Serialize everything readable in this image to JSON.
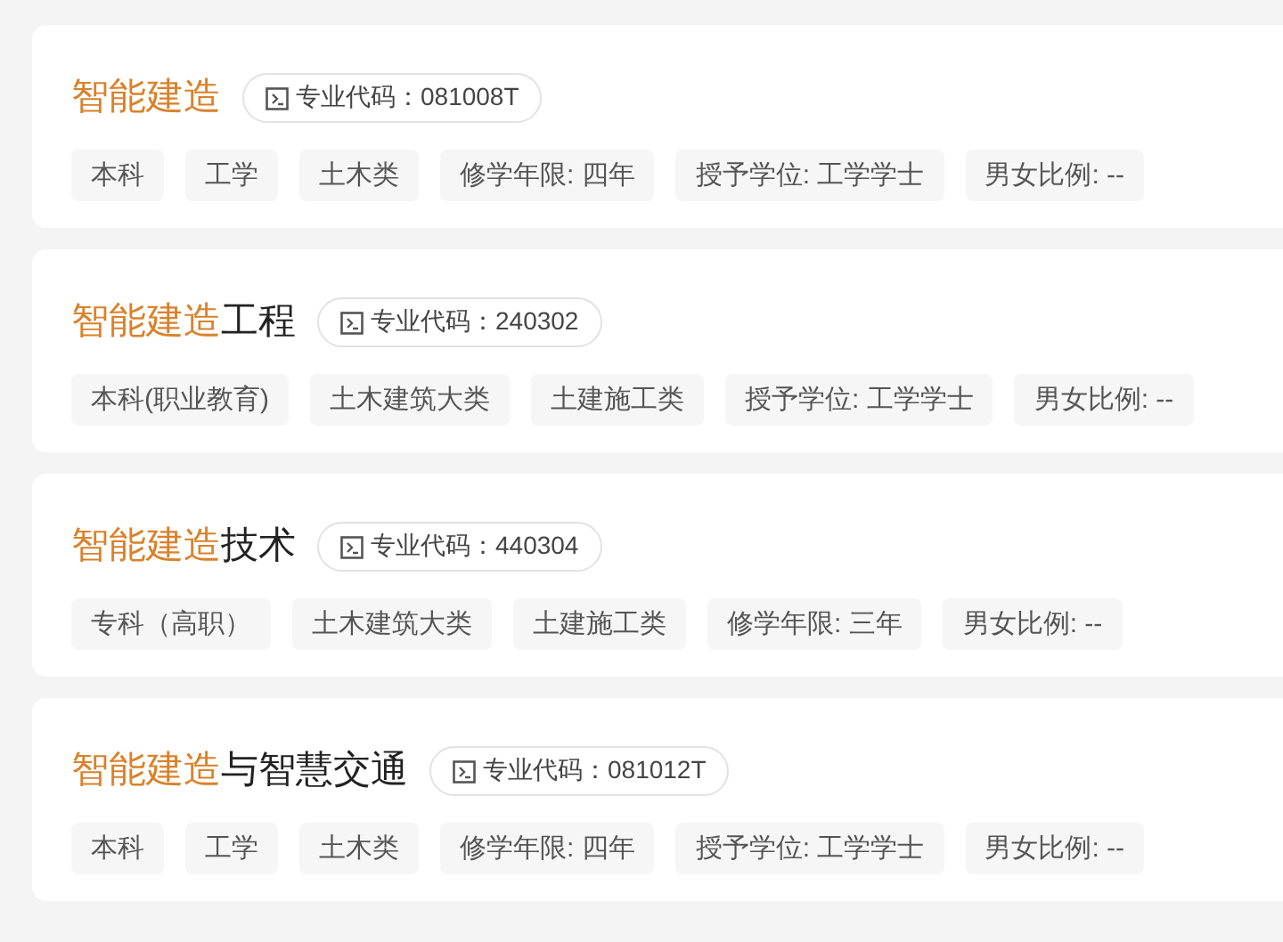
{
  "majors": [
    {
      "title_match": "智能建造",
      "code_label": "专业代码：081008T",
      "tags": [
        "本科",
        "工学",
        "土木类",
        "修学年限: 四年",
        "授予学位: 工学学士",
        "男女比例: --"
      ]
    },
    {
      "title_match": "智能建造",
      "title_rest": "工程",
      "code_label": "专业代码：240302",
      "tags": [
        "本科(职业教育)",
        "土木建筑大类",
        "土建施工类",
        "授予学位: 工学学士",
        "男女比例: --"
      ]
    },
    {
      "title_match": "智能建造",
      "title_rest": "技术",
      "code_label": "专业代码：440304",
      "tags": [
        "专科（高职）",
        "土木建筑大类",
        "土建施工类",
        "修学年限: 三年",
        "男女比例: --"
      ]
    },
    {
      "title_match": "智能建造",
      "title_rest": "与智慧交通",
      "code_label": "专业代码：081012T",
      "tags": [
        "本科",
        "工学",
        "土木类",
        "修学年限: 四年",
        "授予学位: 工学学士",
        "男女比例: --"
      ]
    }
  ]
}
